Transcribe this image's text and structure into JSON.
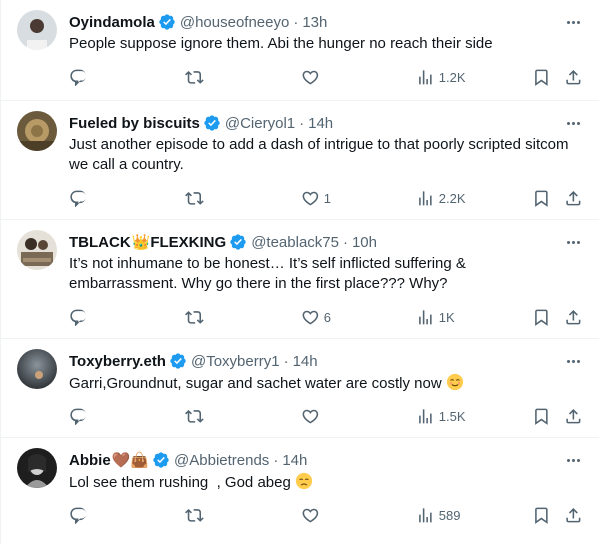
{
  "colors": {
    "verified": "#1d9bf0",
    "secondary_text": "#536471",
    "primary_text": "#0f1419",
    "divider": "#eff3f4"
  },
  "replies": [
    {
      "name": "Oyindamola",
      "handle": "@houseofneeyo",
      "dot": "·",
      "time": "13h",
      "text": "People suppose ignore them. Abi the hunger no reach their side",
      "reply_count": "",
      "retweet_count": "",
      "like_count": "",
      "views": "1.2K"
    },
    {
      "name": "Fueled by biscuits",
      "handle": "@Cieryol1",
      "dot": "·",
      "time": "14h",
      "text": "Just another episode to add a dash of intrigue to that poorly scripted sitcom we call a country.",
      "reply_count": "",
      "retweet_count": "",
      "like_count": "1",
      "views": "2.2K"
    },
    {
      "name": "TBLACK",
      "name_emoji": "👑",
      "name_suffix": "FLEXKING",
      "handle": "@teablack75",
      "dot": "·",
      "time": "10h",
      "text": "It’s not inhumane to be honest… It’s self inflicted suffering & embarrassment. Why go there in the first place??? Why?",
      "reply_count": "",
      "retweet_count": "",
      "like_count": "6",
      "views": "1K"
    },
    {
      "name": "Toxyberry.eth",
      "handle": "@Toxyberry1",
      "dot": "·",
      "time": "14h",
      "text": "Garri,Groundnut, sugar and sachet water are costly now",
      "reply_count": "",
      "retweet_count": "",
      "like_count": "",
      "views": "1.5K"
    },
    {
      "name": "Abbie",
      "name_emoji": "🤎👜",
      "handle": "@Abbietrends",
      "dot": "·",
      "time": "14h",
      "text": "Lol see them rushing  , God abeg",
      "reply_count": "",
      "retweet_count": "",
      "like_count": "",
      "views": "589"
    }
  ]
}
